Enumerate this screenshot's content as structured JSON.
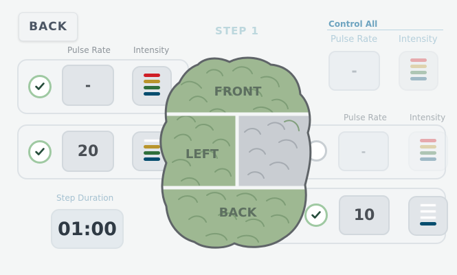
{
  "header": {
    "back_label": "BACK",
    "step_title": "STEP 1",
    "control_all": "Control All"
  },
  "labels": {
    "pulse_rate": "Pulse Rate",
    "intensity": "Intensity"
  },
  "zones": {
    "front_label": "FRONT",
    "left_label": "LEFT",
    "back_label": "BACK",
    "front": {
      "pulse_rate": "-",
      "checked": true,
      "intensity_level": 4,
      "max_intensity": 4
    },
    "left": {
      "pulse_rate": "20",
      "checked": true,
      "intensity_level": 3,
      "max_intensity": 4
    },
    "right": {
      "pulse_rate": "-",
      "checked": false,
      "intensity_level": 0,
      "max_intensity": 4
    },
    "back": {
      "pulse_rate": "10",
      "checked": true,
      "intensity_level": 1,
      "max_intensity": 4
    }
  },
  "control_all": {
    "pulse_rate": "-"
  },
  "step_duration": {
    "label": "Step Duration",
    "value": "01:00"
  },
  "intensity_colors": [
    "#cf1f27",
    "#b9952c",
    "#2f6f3b",
    "#064d6e"
  ],
  "brain_colors": {
    "active": "#9eb892",
    "inactive": "#c9cdd2"
  }
}
